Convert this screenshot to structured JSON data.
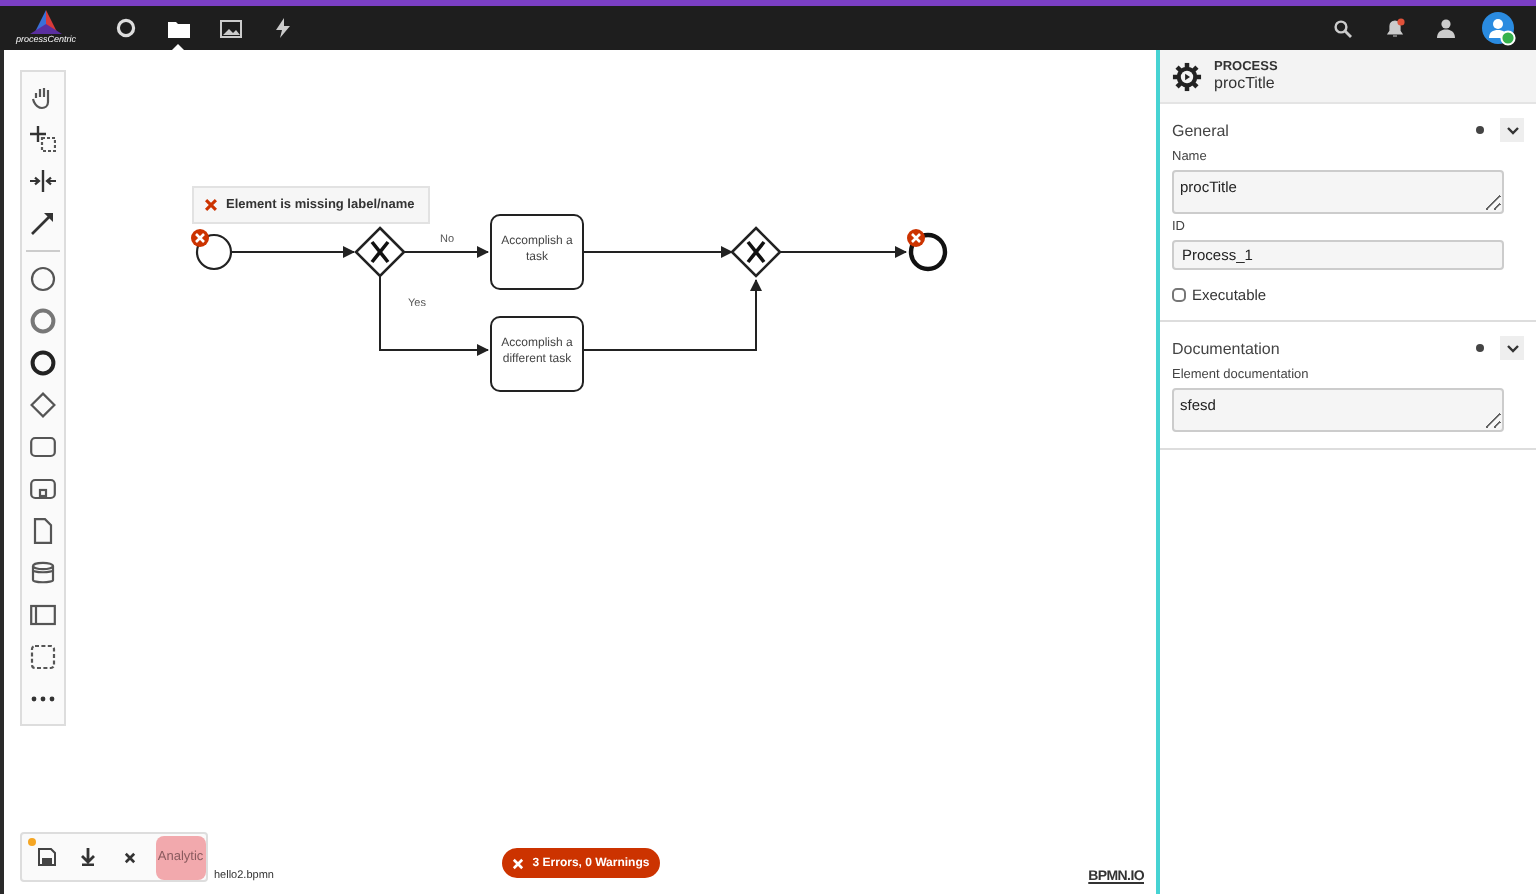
{
  "topbar": {
    "logo_text": "processCentric",
    "nav": [
      {
        "kind": "circle",
        "selected": false
      },
      {
        "kind": "folder",
        "selected": true
      },
      {
        "kind": "image",
        "selected": false
      },
      {
        "kind": "bolt",
        "selected": false
      }
    ],
    "notifications_unread": true
  },
  "palette": [
    {
      "kind": "hand"
    },
    {
      "kind": "lasso"
    },
    {
      "kind": "space"
    },
    {
      "kind": "connect"
    },
    {
      "kind": "separator"
    },
    {
      "kind": "start-event"
    },
    {
      "kind": "intermediate-event"
    },
    {
      "kind": "end-event"
    },
    {
      "kind": "gateway"
    },
    {
      "kind": "task"
    },
    {
      "kind": "subprocess"
    },
    {
      "kind": "data-object"
    },
    {
      "kind": "data-store"
    },
    {
      "kind": "pool"
    },
    {
      "kind": "group"
    },
    {
      "kind": "more"
    }
  ],
  "diagram": {
    "error_message": "Element is missing label/name",
    "tasks": [
      "Accomplish a task",
      "Accomplish a different task"
    ],
    "flow_labels": [
      "No",
      "Yes"
    ]
  },
  "file_toolbar": {
    "unsaved": true,
    "analytic_label": "Analytic",
    "file_name": "hello2.bpmn"
  },
  "status": {
    "label": "3 Errors, 0 Warnings"
  },
  "watermark_link": "BPMN.IO",
  "properties": {
    "element_type": "PROCESS",
    "element_name": "procTitle",
    "groups": [
      {
        "title": "General",
        "has_entries": true,
        "expanded": true,
        "fields": [
          {
            "kind": "textarea",
            "label": "Name",
            "value": "procTitle"
          },
          {
            "kind": "input",
            "label": "ID",
            "value": "Process_1"
          },
          {
            "kind": "checkbox",
            "label": "Executable",
            "checked": false
          }
        ]
      },
      {
        "title": "Documentation",
        "has_entries": true,
        "expanded": true,
        "fields": [
          {
            "kind": "textarea",
            "label": "Element documentation",
            "value": "sfesd"
          }
        ]
      }
    ]
  }
}
